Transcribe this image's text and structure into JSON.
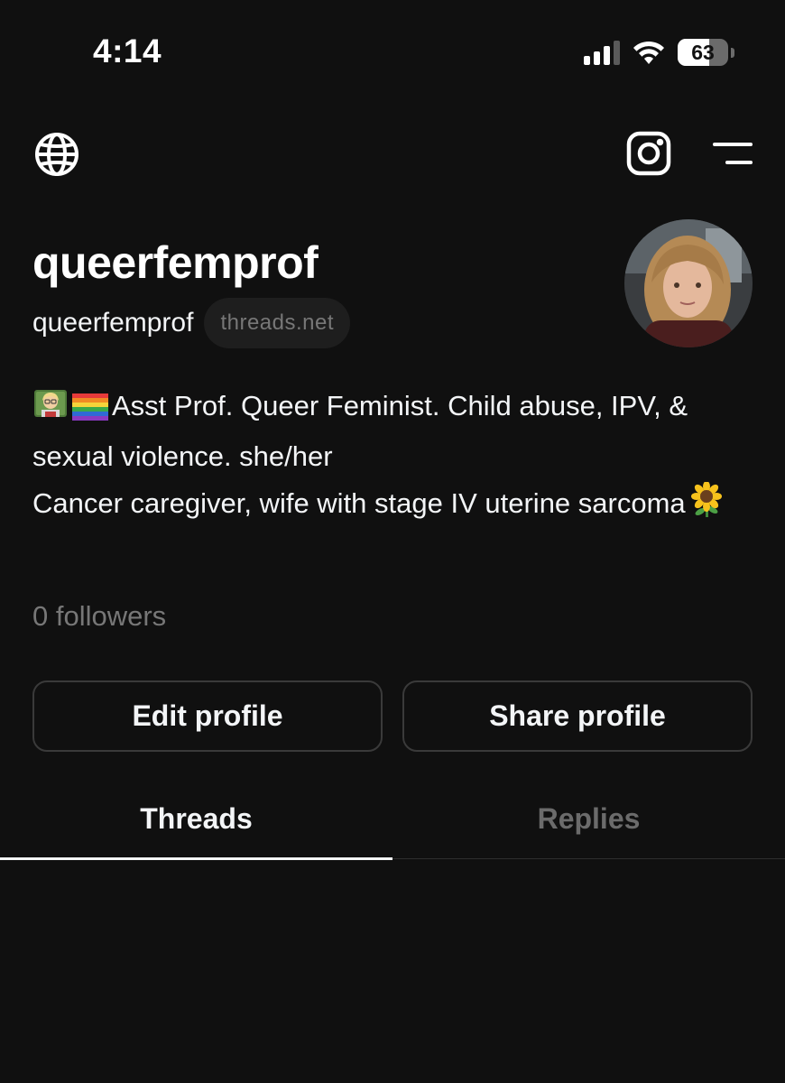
{
  "status_bar": {
    "time": "4:14",
    "battery_percent": "63",
    "battery_level": 0.63,
    "signal_bars_active": 3,
    "signal_bars_total": 4
  },
  "top_bar": {
    "left_icon": "globe-icon",
    "right_icons": [
      "instagram-icon",
      "menu-icon"
    ]
  },
  "profile": {
    "display_name": "queerfemprof",
    "handle": "queerfemprof",
    "domain_badge": "threads.net",
    "bio_line1": "Asst Prof. Queer Feminist. Child abuse, IPV, & sexual violence. she/her",
    "bio_line2": "Cancer caregiver, wife with stage IV uterine sarcoma",
    "bio_emojis": [
      "teacher-emoji",
      "rainbow-flag-emoji",
      "sunflower-emoji"
    ],
    "followers": "0 followers"
  },
  "buttons": {
    "edit": "Edit profile",
    "share": "Share profile"
  },
  "tabs": [
    {
      "label": "Threads",
      "active": true
    },
    {
      "label": "Replies",
      "active": false
    }
  ],
  "colors": {
    "background": "#101010",
    "text_primary": "#f3f5f7",
    "text_secondary": "#777777",
    "border": "#3a3a3a"
  }
}
